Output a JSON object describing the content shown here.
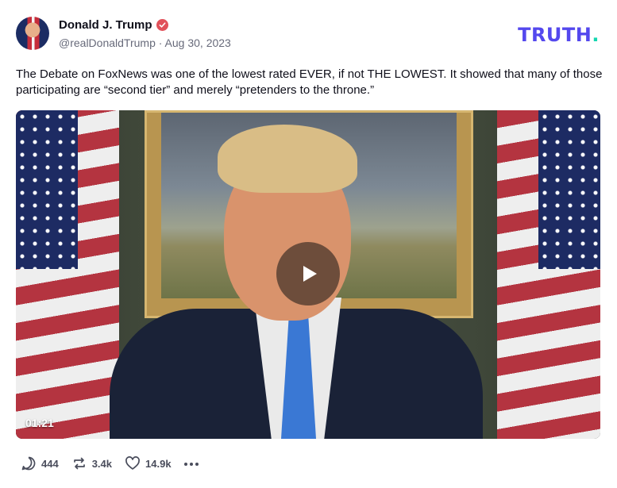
{
  "author": {
    "name": "Donald J. Trump",
    "handle": "@realDonaldTrump",
    "separator": "·",
    "date": "Aug 30, 2023"
  },
  "brand": {
    "logo_text": "TRUTH",
    "logo_dot": "."
  },
  "post": {
    "text": "The Debate on FoxNews was one of the lowest rated EVER, if not THE LOWEST. It showed that many of those participating are “second tier” and merely “pretenders to the throne.”"
  },
  "video": {
    "duration": "01:21"
  },
  "actions": {
    "replies": "444",
    "retruths": "3.4k",
    "likes": "14.9k"
  },
  "colors": {
    "brand": "#5448ee",
    "brand_dot": "#14d6b0",
    "verified": "#e1515a"
  }
}
